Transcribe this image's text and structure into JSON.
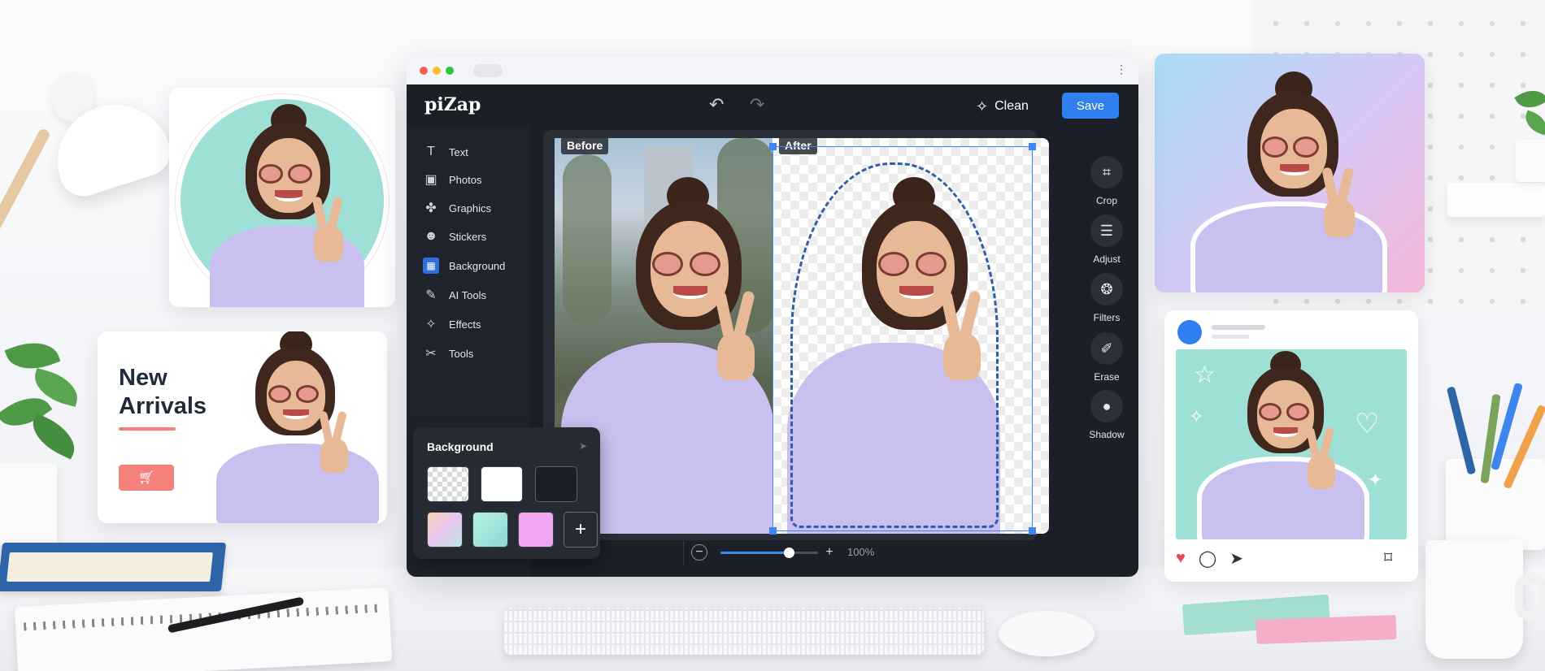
{
  "app": {
    "logo": "piZap",
    "header": {
      "undo_icon": "undo-icon",
      "redo_icon": "redo-icon",
      "clean_label": "Clean",
      "clean_icon": "sparkle-icon",
      "save_label": "Save"
    },
    "sidebar": {
      "items": [
        {
          "label": "Text",
          "icon": "text-icon",
          "glyph": "T"
        },
        {
          "label": "Photos",
          "icon": "photo-icon",
          "glyph": "▣"
        },
        {
          "label": "Graphics",
          "icon": "graphics-icon",
          "glyph": "✤"
        },
        {
          "label": "Stickers",
          "icon": "sticker-icon",
          "glyph": "☻"
        },
        {
          "label": "Background",
          "icon": "background-icon",
          "glyph": "▦",
          "active": true
        },
        {
          "label": "AI Tools",
          "icon": "ai-tools-icon",
          "glyph": "✎"
        },
        {
          "label": "Effects",
          "icon": "effects-icon",
          "glyph": "✧"
        },
        {
          "label": "Tools",
          "icon": "tools-icon",
          "glyph": "✂"
        }
      ]
    },
    "background_panel": {
      "title": "Background",
      "swatches": [
        "transparent",
        "#ffffff",
        "#1b1f27",
        "gradient-peach",
        "gradient-mint",
        "#f0a6f0"
      ],
      "add_glyph": "+"
    },
    "canvas": {
      "before_label": "Before",
      "after_label": "After"
    },
    "right_tools": [
      {
        "label": "Crop",
        "icon": "crop-icon",
        "glyph": "⌗"
      },
      {
        "label": "Adjust",
        "icon": "sliders-icon",
        "glyph": "☰"
      },
      {
        "label": "Filters",
        "icon": "filters-icon",
        "glyph": "❂"
      },
      {
        "label": "Erase",
        "icon": "eraser-icon",
        "glyph": "✐"
      },
      {
        "label": "Shadow",
        "icon": "shadow-icon",
        "glyph": "●"
      }
    ],
    "zoom": {
      "minus": "−",
      "plus": "+",
      "level_label": "100%",
      "level": 0.7
    }
  },
  "cards": {
    "promo": {
      "title_line1": "New",
      "title_line2": "Arrivals",
      "cart_icon": "cart-icon"
    }
  },
  "colors": {
    "accent_blue": "#2f7ff0",
    "editor_bg": "#1b1f27",
    "sweater": "#c9c0ef",
    "mint": "#9fe0d6",
    "coral": "#f5827a"
  }
}
